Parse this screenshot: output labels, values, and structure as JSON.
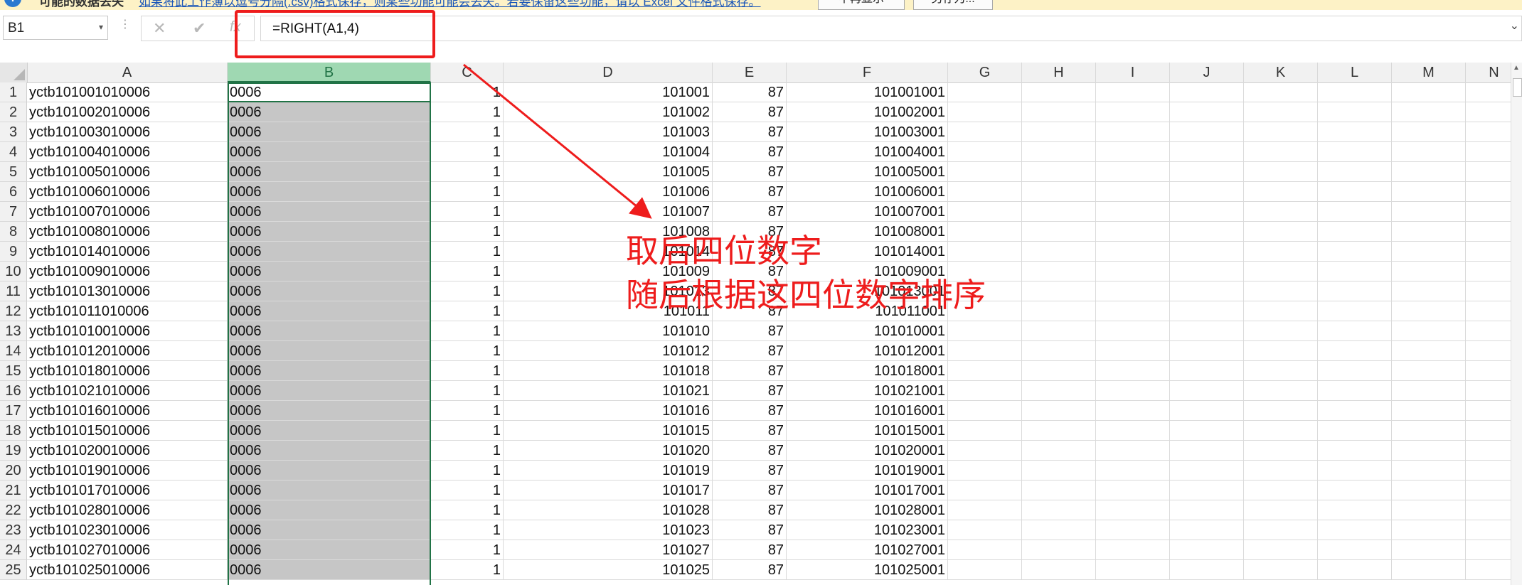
{
  "notification": {
    "title": "可能的数据丢失",
    "message": "如果将此工作簿以逗号分隔(.csv)格式保存，则某些功能可能会丢失。若要保留这些功能，请以 Excel 文件格式保存。",
    "button_dont_show": "不再显示",
    "button_save_as": "另存为..."
  },
  "formula_bar": {
    "name_box": "B1",
    "formula": "=RIGHT(A1,4)",
    "fx_label": "fx"
  },
  "columns": [
    "A",
    "B",
    "C",
    "D",
    "E",
    "F",
    "G",
    "H",
    "I",
    "J",
    "K",
    "L",
    "M",
    "N"
  ],
  "rows": [
    {
      "n": "1",
      "a": "yctb101001010006",
      "b": "0006",
      "c": "1",
      "d": "101001",
      "e": "87",
      "f": "101001001"
    },
    {
      "n": "2",
      "a": "yctb101002010006",
      "b": "0006",
      "c": "1",
      "d": "101002",
      "e": "87",
      "f": "101002001"
    },
    {
      "n": "3",
      "a": "yctb101003010006",
      "b": "0006",
      "c": "1",
      "d": "101003",
      "e": "87",
      "f": "101003001"
    },
    {
      "n": "4",
      "a": "yctb101004010006",
      "b": "0006",
      "c": "1",
      "d": "101004",
      "e": "87",
      "f": "101004001"
    },
    {
      "n": "5",
      "a": "yctb101005010006",
      "b": "0006",
      "c": "1",
      "d": "101005",
      "e": "87",
      "f": "101005001"
    },
    {
      "n": "6",
      "a": "yctb101006010006",
      "b": "0006",
      "c": "1",
      "d": "101006",
      "e": "87",
      "f": "101006001"
    },
    {
      "n": "7",
      "a": "yctb101007010006",
      "b": "0006",
      "c": "1",
      "d": "101007",
      "e": "87",
      "f": "101007001"
    },
    {
      "n": "8",
      "a": "yctb101008010006",
      "b": "0006",
      "c": "1",
      "d": "101008",
      "e": "87",
      "f": "101008001"
    },
    {
      "n": "9",
      "a": "yctb101014010006",
      "b": "0006",
      "c": "1",
      "d": "101014",
      "e": "87",
      "f": "101014001"
    },
    {
      "n": "10",
      "a": "yctb101009010006",
      "b": "0006",
      "c": "1",
      "d": "101009",
      "e": "87",
      "f": "101009001"
    },
    {
      "n": "11",
      "a": "yctb101013010006",
      "b": "0006",
      "c": "1",
      "d": "101013",
      "e": "87",
      "f": "101013001"
    },
    {
      "n": "12",
      "a": "yctb101011010006",
      "b": "0006",
      "c": "1",
      "d": "101011",
      "e": "87",
      "f": "101011001"
    },
    {
      "n": "13",
      "a": "yctb101010010006",
      "b": "0006",
      "c": "1",
      "d": "101010",
      "e": "87",
      "f": "101010001"
    },
    {
      "n": "14",
      "a": "yctb101012010006",
      "b": "0006",
      "c": "1",
      "d": "101012",
      "e": "87",
      "f": "101012001"
    },
    {
      "n": "15",
      "a": "yctb101018010006",
      "b": "0006",
      "c": "1",
      "d": "101018",
      "e": "87",
      "f": "101018001"
    },
    {
      "n": "16",
      "a": "yctb101021010006",
      "b": "0006",
      "c": "1",
      "d": "101021",
      "e": "87",
      "f": "101021001"
    },
    {
      "n": "17",
      "a": "yctb101016010006",
      "b": "0006",
      "c": "1",
      "d": "101016",
      "e": "87",
      "f": "101016001"
    },
    {
      "n": "18",
      "a": "yctb101015010006",
      "b": "0006",
      "c": "1",
      "d": "101015",
      "e": "87",
      "f": "101015001"
    },
    {
      "n": "19",
      "a": "yctb101020010006",
      "b": "0006",
      "c": "1",
      "d": "101020",
      "e": "87",
      "f": "101020001"
    },
    {
      "n": "20",
      "a": "yctb101019010006",
      "b": "0006",
      "c": "1",
      "d": "101019",
      "e": "87",
      "f": "101019001"
    },
    {
      "n": "21",
      "a": "yctb101017010006",
      "b": "0006",
      "c": "1",
      "d": "101017",
      "e": "87",
      "f": "101017001"
    },
    {
      "n": "22",
      "a": "yctb101028010006",
      "b": "0006",
      "c": "1",
      "d": "101028",
      "e": "87",
      "f": "101028001"
    },
    {
      "n": "23",
      "a": "yctb101023010006",
      "b": "0006",
      "c": "1",
      "d": "101023",
      "e": "87",
      "f": "101023001"
    },
    {
      "n": "24",
      "a": "yctb101027010006",
      "b": "0006",
      "c": "1",
      "d": "101027",
      "e": "87",
      "f": "101027001"
    },
    {
      "n": "25",
      "a": "yctb101025010006",
      "b": "0006",
      "c": "1",
      "d": "101025",
      "e": "87",
      "f": "101025001"
    }
  ],
  "annotation": {
    "line1": "取后四位数字",
    "line2": "随后根据这四位数字排序",
    "color": "#ee1c1c"
  },
  "icons": {
    "cancel": "close-icon",
    "enter": "check-icon",
    "function": "fx-icon",
    "namebox_dropdown": "chevron-down-icon"
  },
  "accent_color": "#217346"
}
